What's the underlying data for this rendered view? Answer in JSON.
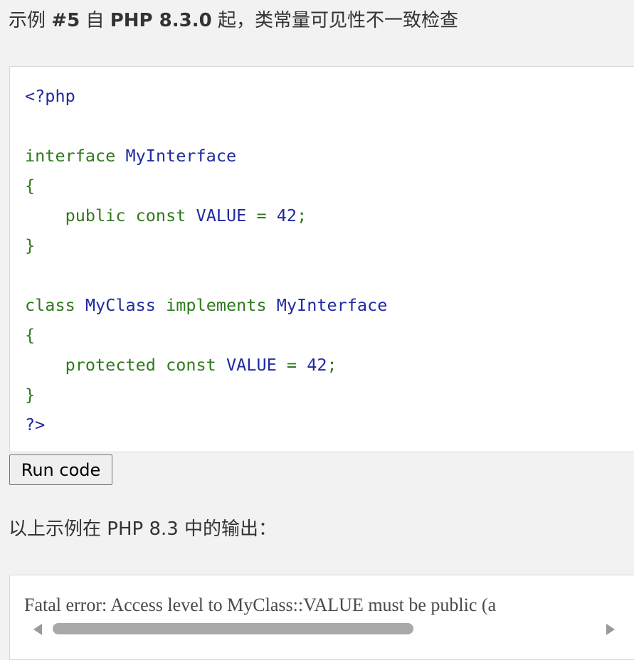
{
  "example": {
    "title_prefix": "示例",
    "title_number": "#5",
    "title_mid": "自",
    "title_version": "PHP 8.3.0",
    "title_suffix": "起，类常量可见性不一致检查"
  },
  "code": {
    "open_tag": "<?php",
    "interface_keyword": "interface",
    "interface_name": "MyInterface",
    "brace_open": "{",
    "brace_close": "}",
    "public_keyword": "public",
    "const_keyword": "const",
    "const_name": "VALUE",
    "equals": "=",
    "value": "42",
    "semicolon": ";",
    "class_keyword": "class",
    "class_name": "MyClass",
    "implements_keyword": "implements",
    "protected_keyword": "protected",
    "close_tag": "?>"
  },
  "run_button": {
    "label": "Run code"
  },
  "output": {
    "caption": "以上示例在 PHP 8.3 中的输出：",
    "text": "Fatal error: Access level to MyClass::VALUE must be public (a"
  },
  "colors": {
    "keyword": "#2f7a1c",
    "identifier": "#1f2aa0",
    "background": "#f2f2f2"
  }
}
